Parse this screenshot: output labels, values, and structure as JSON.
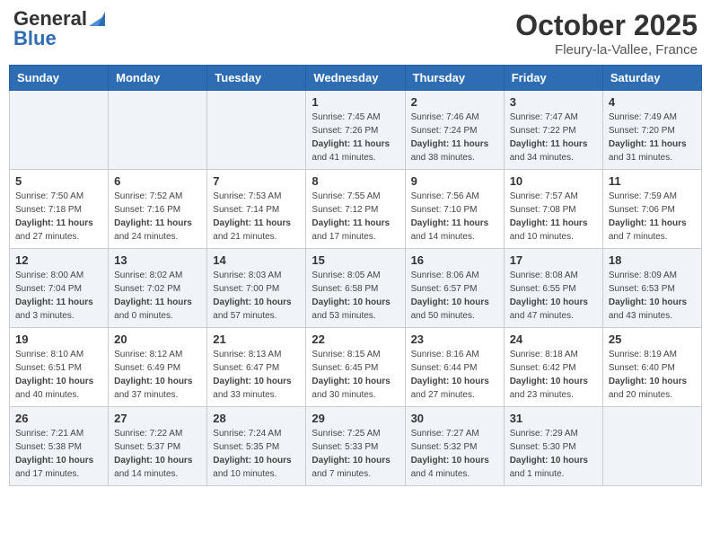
{
  "header": {
    "logo_general": "General",
    "logo_blue": "Blue",
    "month_title": "October 2025",
    "location": "Fleury-la-Vallee, France"
  },
  "weekdays": [
    "Sunday",
    "Monday",
    "Tuesday",
    "Wednesday",
    "Thursday",
    "Friday",
    "Saturday"
  ],
  "weeks": [
    [
      {
        "day": "",
        "info": ""
      },
      {
        "day": "",
        "info": ""
      },
      {
        "day": "",
        "info": ""
      },
      {
        "day": "1",
        "info": "Sunrise: 7:45 AM\nSunset: 7:26 PM\nDaylight: 11 hours\nand 41 minutes."
      },
      {
        "day": "2",
        "info": "Sunrise: 7:46 AM\nSunset: 7:24 PM\nDaylight: 11 hours\nand 38 minutes."
      },
      {
        "day": "3",
        "info": "Sunrise: 7:47 AM\nSunset: 7:22 PM\nDaylight: 11 hours\nand 34 minutes."
      },
      {
        "day": "4",
        "info": "Sunrise: 7:49 AM\nSunset: 7:20 PM\nDaylight: 11 hours\nand 31 minutes."
      }
    ],
    [
      {
        "day": "5",
        "info": "Sunrise: 7:50 AM\nSunset: 7:18 PM\nDaylight: 11 hours\nand 27 minutes."
      },
      {
        "day": "6",
        "info": "Sunrise: 7:52 AM\nSunset: 7:16 PM\nDaylight: 11 hours\nand 24 minutes."
      },
      {
        "day": "7",
        "info": "Sunrise: 7:53 AM\nSunset: 7:14 PM\nDaylight: 11 hours\nand 21 minutes."
      },
      {
        "day": "8",
        "info": "Sunrise: 7:55 AM\nSunset: 7:12 PM\nDaylight: 11 hours\nand 17 minutes."
      },
      {
        "day": "9",
        "info": "Sunrise: 7:56 AM\nSunset: 7:10 PM\nDaylight: 11 hours\nand 14 minutes."
      },
      {
        "day": "10",
        "info": "Sunrise: 7:57 AM\nSunset: 7:08 PM\nDaylight: 11 hours\nand 10 minutes."
      },
      {
        "day": "11",
        "info": "Sunrise: 7:59 AM\nSunset: 7:06 PM\nDaylight: 11 hours\nand 7 minutes."
      }
    ],
    [
      {
        "day": "12",
        "info": "Sunrise: 8:00 AM\nSunset: 7:04 PM\nDaylight: 11 hours\nand 3 minutes."
      },
      {
        "day": "13",
        "info": "Sunrise: 8:02 AM\nSunset: 7:02 PM\nDaylight: 11 hours\nand 0 minutes."
      },
      {
        "day": "14",
        "info": "Sunrise: 8:03 AM\nSunset: 7:00 PM\nDaylight: 10 hours\nand 57 minutes."
      },
      {
        "day": "15",
        "info": "Sunrise: 8:05 AM\nSunset: 6:58 PM\nDaylight: 10 hours\nand 53 minutes."
      },
      {
        "day": "16",
        "info": "Sunrise: 8:06 AM\nSunset: 6:57 PM\nDaylight: 10 hours\nand 50 minutes."
      },
      {
        "day": "17",
        "info": "Sunrise: 8:08 AM\nSunset: 6:55 PM\nDaylight: 10 hours\nand 47 minutes."
      },
      {
        "day": "18",
        "info": "Sunrise: 8:09 AM\nSunset: 6:53 PM\nDaylight: 10 hours\nand 43 minutes."
      }
    ],
    [
      {
        "day": "19",
        "info": "Sunrise: 8:10 AM\nSunset: 6:51 PM\nDaylight: 10 hours\nand 40 minutes."
      },
      {
        "day": "20",
        "info": "Sunrise: 8:12 AM\nSunset: 6:49 PM\nDaylight: 10 hours\nand 37 minutes."
      },
      {
        "day": "21",
        "info": "Sunrise: 8:13 AM\nSunset: 6:47 PM\nDaylight: 10 hours\nand 33 minutes."
      },
      {
        "day": "22",
        "info": "Sunrise: 8:15 AM\nSunset: 6:45 PM\nDaylight: 10 hours\nand 30 minutes."
      },
      {
        "day": "23",
        "info": "Sunrise: 8:16 AM\nSunset: 6:44 PM\nDaylight: 10 hours\nand 27 minutes."
      },
      {
        "day": "24",
        "info": "Sunrise: 8:18 AM\nSunset: 6:42 PM\nDaylight: 10 hours\nand 23 minutes."
      },
      {
        "day": "25",
        "info": "Sunrise: 8:19 AM\nSunset: 6:40 PM\nDaylight: 10 hours\nand 20 minutes."
      }
    ],
    [
      {
        "day": "26",
        "info": "Sunrise: 7:21 AM\nSunset: 5:38 PM\nDaylight: 10 hours\nand 17 minutes."
      },
      {
        "day": "27",
        "info": "Sunrise: 7:22 AM\nSunset: 5:37 PM\nDaylight: 10 hours\nand 14 minutes."
      },
      {
        "day": "28",
        "info": "Sunrise: 7:24 AM\nSunset: 5:35 PM\nDaylight: 10 hours\nand 10 minutes."
      },
      {
        "day": "29",
        "info": "Sunrise: 7:25 AM\nSunset: 5:33 PM\nDaylight: 10 hours\nand 7 minutes."
      },
      {
        "day": "30",
        "info": "Sunrise: 7:27 AM\nSunset: 5:32 PM\nDaylight: 10 hours\nand 4 minutes."
      },
      {
        "day": "31",
        "info": "Sunrise: 7:29 AM\nSunset: 5:30 PM\nDaylight: 10 hours\nand 1 minute."
      },
      {
        "day": "",
        "info": ""
      }
    ]
  ]
}
